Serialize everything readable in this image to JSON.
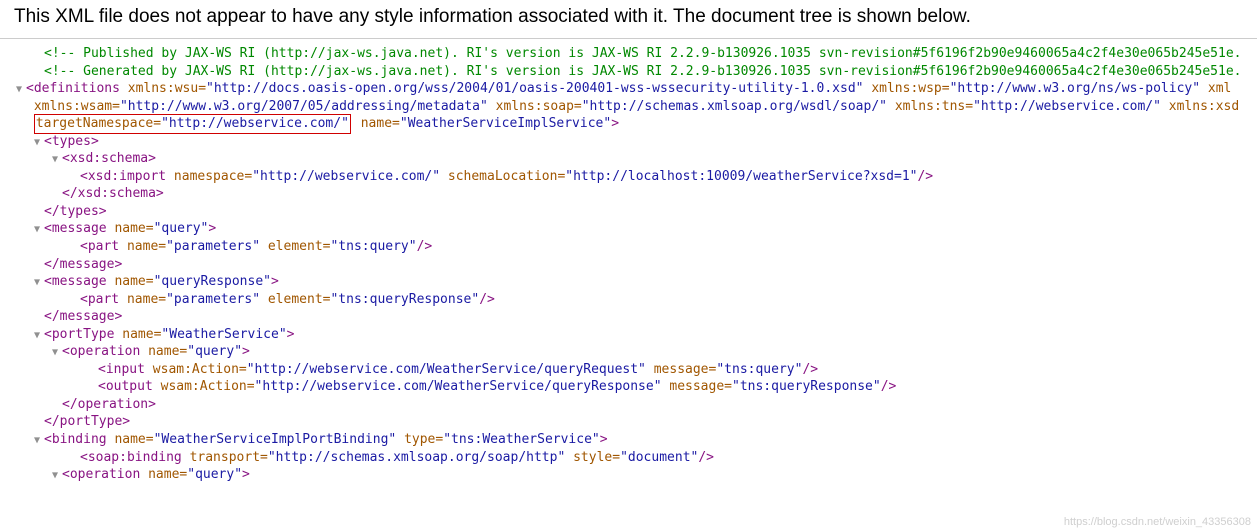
{
  "header": "This XML file does not appear to have any style information associated with it. The document tree is shown below.",
  "c1": "<!--  Published by JAX-WS RI (http://jax-ws.java.net). RI's version is JAX-WS RI 2.2.9-b130926.1035 svn-revision#5f6196f2b90e9460065a4c2f4e30e065b245e51e.",
  "c2": "<!--  Generated by JAX-WS RI (http://jax-ws.java.net). RI's version is JAX-WS RI 2.2.9-b130926.1035 svn-revision#5f6196f2b90e9460065a4c2f4e30e065b245e51e.",
  "defs": {
    "open": "<definitions",
    "a1n": "xmlns:wsu",
    "a1v": "\"http://docs.oasis-open.org/wss/2004/01/oasis-200401-wss-wssecurity-utility-1.0.xsd\"",
    "a2n": "xmlns:wsp",
    "a2v": "\"http://www.w3.org/ns/ws-policy\"",
    "a3n": "xml",
    "a4n": "xmlns:wsam",
    "a4v": "\"http://www.w3.org/2007/05/addressing/metadata\"",
    "a5n": "xmlns:soap",
    "a5v": "\"http://schemas.xmlsoap.org/wsdl/soap/\"",
    "a6n": "xmlns:tns",
    "a6v": "\"http://webservice.com/\"",
    "a7n": "xmlns:xsd",
    "tnN": "targetNamespace",
    "tnV": "\"http://webservice.com/\"",
    "nmN": "name",
    "nmV": "\"WeatherServiceImplService\"",
    "gt": ">"
  },
  "types": {
    "open": "<types>",
    "close": "</types>",
    "xsdOpen": "<xsd:schema>",
    "xsdClose": "</xsd:schema>",
    "impOpen": "<xsd:import",
    "impA1n": "namespace",
    "impA1v": "\"http://webservice.com/\"",
    "impA2n": "schemaLocation",
    "impA2v": "\"http://localhost:10009/weatherService?xsd=1\"",
    "impEnd": "/>"
  },
  "msg1": {
    "open": "<message",
    "nameN": "name",
    "nameV": "\"query\"",
    "gt": ">",
    "close": "</message>",
    "pOpen": "<part",
    "p1n": "name",
    "p1v": "\"parameters\"",
    "p2n": "element",
    "p2v": "\"tns:query\"",
    "pEnd": "/>"
  },
  "msg2": {
    "open": "<message",
    "nameN": "name",
    "nameV": "\"queryResponse\"",
    "gt": ">",
    "close": "</message>",
    "pOpen": "<part",
    "p1n": "name",
    "p1v": "\"parameters\"",
    "p2n": "element",
    "p2v": "\"tns:queryResponse\"",
    "pEnd": "/>"
  },
  "pt": {
    "open": "<portType",
    "nN": "name",
    "nV": "\"WeatherService\"",
    "gt": ">",
    "close": "</portType>",
    "opOpen": "<operation",
    "opNn": "name",
    "opNv": "\"query\"",
    "opGt": ">",
    "opClose": "</operation>",
    "inOpen": "<input",
    "inA1n": "wsam:Action",
    "inA1v": "\"http://webservice.com/WeatherService/queryRequest\"",
    "inA2n": "message",
    "inA2v": "\"tns:query\"",
    "inEnd": "/>",
    "outOpen": "<output",
    "outA1n": "wsam:Action",
    "outA1v": "\"http://webservice.com/WeatherService/queryResponse\"",
    "outA2n": "message",
    "outA2v": "\"tns:queryResponse\"",
    "outEnd": "/>"
  },
  "bind": {
    "open": "<binding",
    "nN": "name",
    "nV": "\"WeatherServiceImplPortBinding\"",
    "tN": "type",
    "tV": "\"tns:WeatherService\"",
    "gt": ">",
    "sbOpen": "<soap:binding",
    "sbA1n": "transport",
    "sbA1v": "\"http://schemas.xmlsoap.org/soap/http\"",
    "sbA2n": "style",
    "sbA2v": "\"document\"",
    "sbEnd": "/>",
    "opOpen": "<operation",
    "opNn": "name",
    "opNv": "\"query\"",
    "opGt": ">"
  },
  "eq": "=",
  "watermark": "https://blog.csdn.net/weixin_43356308"
}
